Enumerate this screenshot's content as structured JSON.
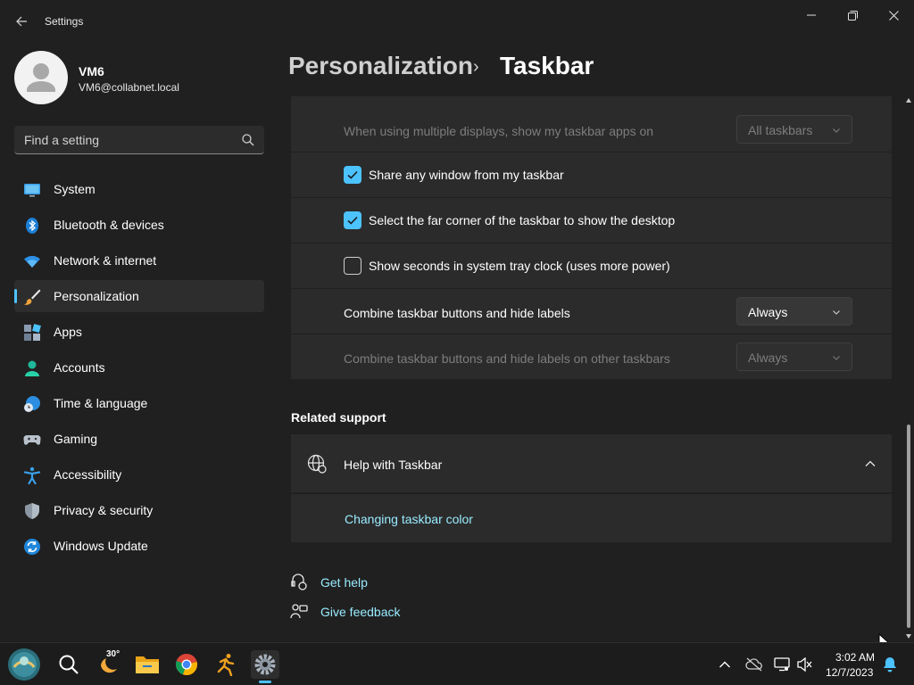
{
  "window": {
    "app_title": "Settings",
    "back_icon": "arrow-left-icon",
    "controls": [
      "minimize-icon",
      "maximize-icon",
      "close-icon"
    ]
  },
  "profile": {
    "name": "VM6",
    "email": "VM6@collabnet.local"
  },
  "search": {
    "placeholder": "Find a setting",
    "value": ""
  },
  "sidebar": {
    "accent": "#4cc2ff",
    "items": [
      {
        "label": "System",
        "icon": "monitor-icon"
      },
      {
        "label": "Bluetooth & devices",
        "icon": "bluetooth-icon"
      },
      {
        "label": "Network & internet",
        "icon": "wifi-icon"
      },
      {
        "label": "Personalization",
        "icon": "paintbrush-icon",
        "active": true
      },
      {
        "label": "Apps",
        "icon": "apps-grid-icon"
      },
      {
        "label": "Accounts",
        "icon": "person-icon"
      },
      {
        "label": "Time & language",
        "icon": "globe-clock-icon"
      },
      {
        "label": "Gaming",
        "icon": "gamepad-icon"
      },
      {
        "label": "Accessibility",
        "icon": "accessibility-icon"
      },
      {
        "label": "Privacy & security",
        "icon": "shield-icon"
      },
      {
        "label": "Windows Update",
        "icon": "update-sync-icon"
      }
    ]
  },
  "header": {
    "parent": "Personalization",
    "separator": "›",
    "current": "Taskbar"
  },
  "settings": {
    "multi_display": {
      "label": "When using multiple displays, show my taskbar apps on",
      "value": "All taskbars",
      "disabled": true
    },
    "share_window": {
      "label": "Share any window from my taskbar",
      "checked": true
    },
    "far_corner": {
      "label": "Select the far corner of the taskbar to show the desktop",
      "checked": true
    },
    "show_seconds": {
      "label": "Show seconds in system tray clock (uses more power)",
      "checked": false
    },
    "combine_buttons": {
      "label": "Combine taskbar buttons and hide labels",
      "value": "Always",
      "disabled": false
    },
    "combine_other": {
      "label": "Combine taskbar buttons and hide labels on other taskbars",
      "value": "Always",
      "disabled": true
    }
  },
  "related": {
    "title": "Related support",
    "help_title": "Help with Taskbar",
    "help_link": "Changing taskbar color"
  },
  "footer_links": {
    "get_help": "Get help",
    "give_feedback": "Give feedback"
  },
  "taskbar": {
    "weather_temp": "30°",
    "time": "3:02 AM",
    "date": "12/7/2023",
    "apps": [
      "start-icon",
      "search-icon",
      "weather-icon",
      "file-explorer-icon",
      "chrome-icon",
      "runner-app-icon",
      "settings-gear-icon"
    ],
    "tray": [
      "chevron-up-icon",
      "cloud-offline-icon",
      "network-display-icon",
      "speaker-muted-icon",
      "notification-bell-icon"
    ]
  }
}
